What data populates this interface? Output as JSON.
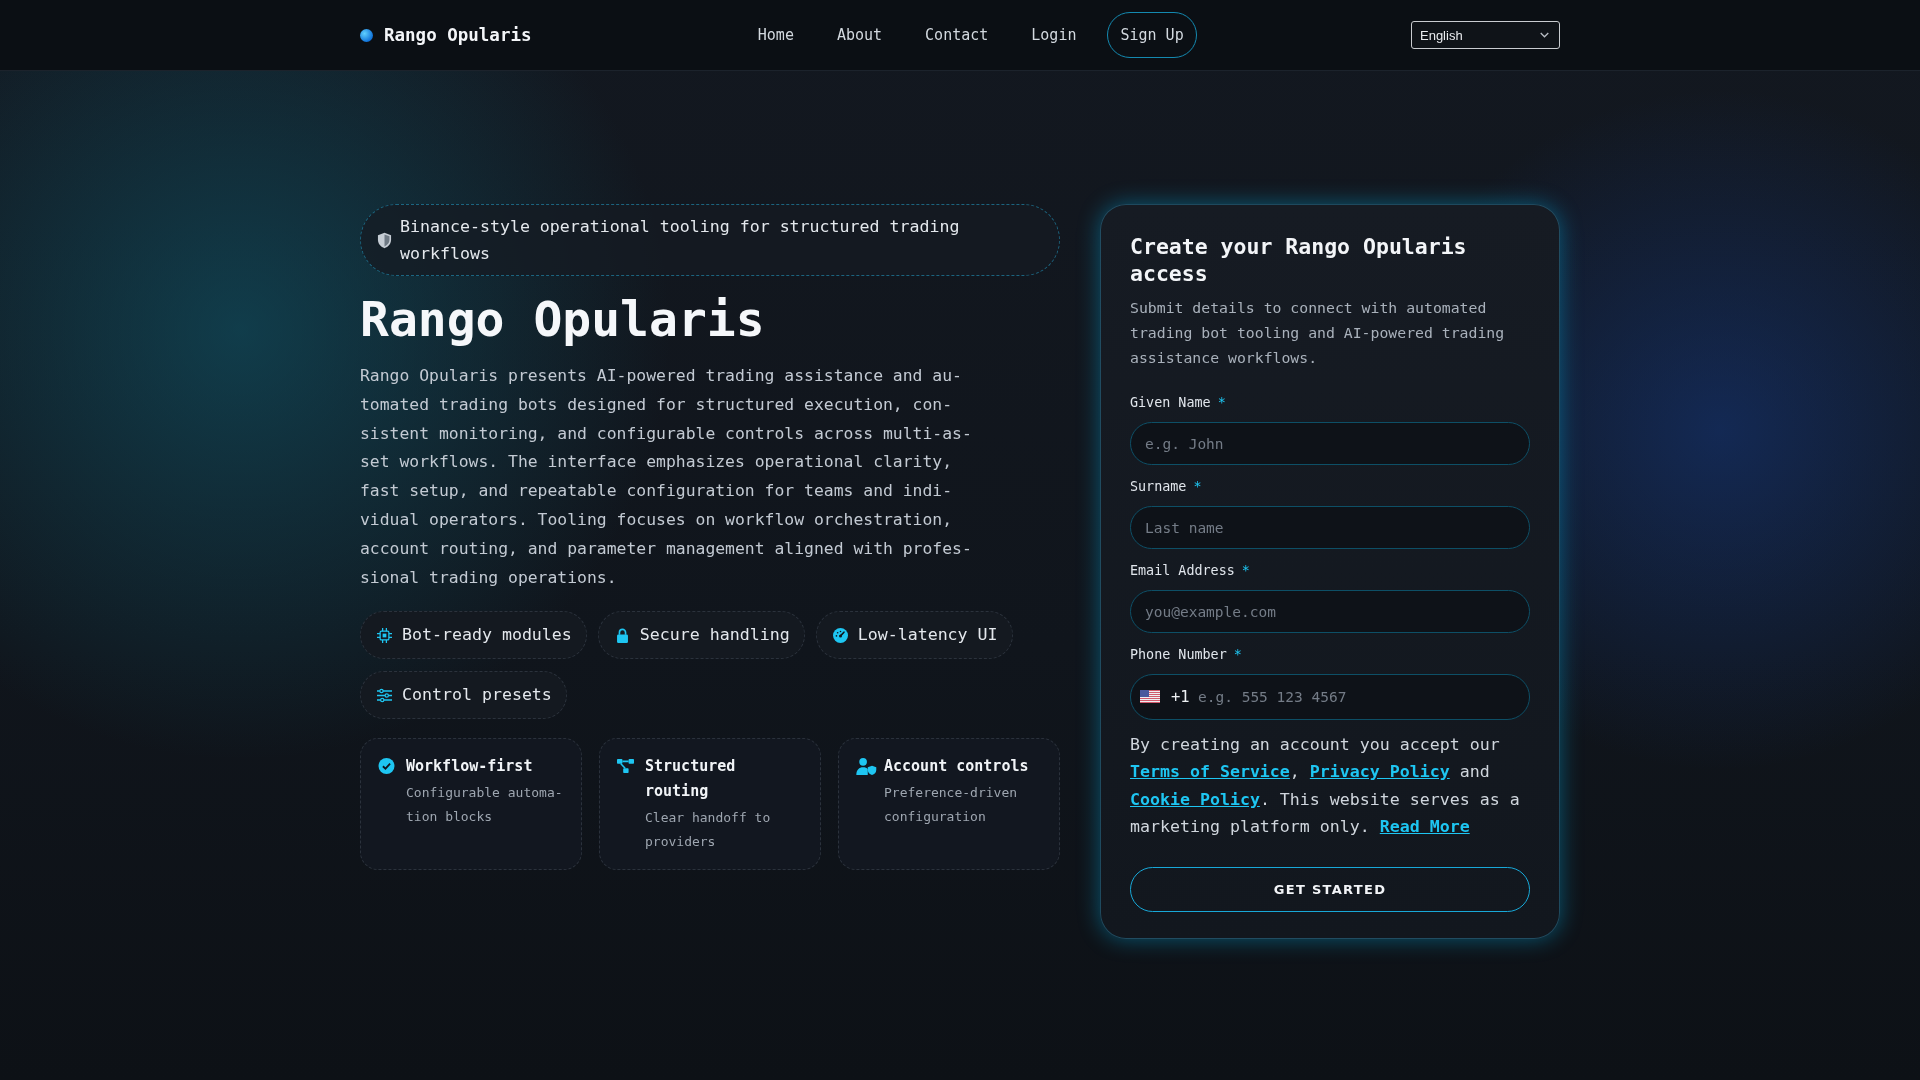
{
  "nav": {
    "logo": "Rango Opularis",
    "links": [
      {
        "kind": "link",
        "label": "Home"
      },
      {
        "kind": "link",
        "label": "About"
      },
      {
        "kind": "link",
        "label": "Contact"
      },
      {
        "kind": "link",
        "label": "Login"
      },
      {
        "kind": "button",
        "label": "Sign Up"
      }
    ],
    "language": "English"
  },
  "hero": {
    "badge": "Binance-style operational tooling for structured trading workflows",
    "title": "Rango Opularis",
    "description": "Rango Opularis presents AI-powered trading assistance and au-tomated trading bots designed for structured execution, con-sistent monitoring, and configurable controls across multi-as-set workflows. The interface emphasizes operational clarity, fast setup, and repeatable configuration for teams and indi-vidual operators. Tooling focuses on workflow orchestration, account routing, and parameter management aligned with profes-sional trading operations.",
    "chips": [
      "Bot-ready modules",
      "Secure handling",
      "Low-latency UI",
      "Control presets"
    ],
    "cards": [
      {
        "title": "Workflow-first",
        "text": "Configurable automa-tion blocks"
      },
      {
        "title": "Structured routing",
        "text": "Clear handoff to providers"
      },
      {
        "title": "Account controls",
        "text": "Preference-driven configuration"
      }
    ]
  },
  "signup": {
    "title": "Create your Rango Opularis access",
    "subtitle": "Submit details to connect with automated trading bot tooling and AI-powered trading assistance workflows.",
    "fields": [
      {
        "kind": "text",
        "label": "Given Name",
        "required_mark": "*",
        "placeholder": "e.g. John"
      },
      {
        "kind": "text",
        "label": "Surname",
        "required_mark": "*",
        "placeholder": "Last name"
      },
      {
        "kind": "text",
        "label": "Email Address",
        "required_mark": "*",
        "placeholder": "you@example.com"
      },
      {
        "kind": "phone",
        "label": "Phone Number",
        "required_mark": "*",
        "dial_code": "+1",
        "placeholder": "e.g. 555 123 4567"
      }
    ],
    "legal": [
      {
        "kind": "text",
        "text": "By creating an account you accept our "
      },
      {
        "kind": "link",
        "text": "Terms of Service"
      },
      {
        "kind": "text",
        "text": ", "
      },
      {
        "kind": "link",
        "text": "Privacy Policy"
      },
      {
        "kind": "text",
        "text": " and "
      },
      {
        "kind": "link",
        "text": "Cookie Policy"
      },
      {
        "kind": "text",
        "text": ". This website serves as a marketing platform only. "
      },
      {
        "kind": "link",
        "text": "Read More"
      }
    ],
    "submit": "GET STARTED"
  }
}
